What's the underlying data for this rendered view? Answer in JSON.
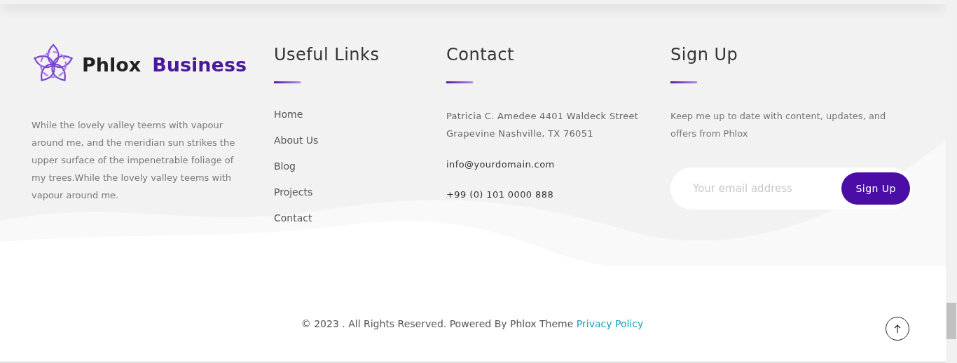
{
  "brand": {
    "name": "Phlox",
    "accent": "Business"
  },
  "about": "While the lovely valley teems with vapour around me, and the meridian sun strikes the upper surface of the impenetrable foliage of my trees.While the lovely valley teems with vapour around me.",
  "useful_links": {
    "title": "Useful Links",
    "items": [
      "Home",
      "About Us",
      "Blog",
      "Projects",
      "Contact"
    ]
  },
  "contact": {
    "title": "Contact",
    "address": "Patricia C. Amedee 4401 Waldeck Street Grapevine Nashville, TX 76051",
    "email": "info@yourdomain.com",
    "phone": "+99 (0) 101 0000 888"
  },
  "signup": {
    "title": "Sign Up",
    "text": "Keep me up to date with content, updates, and offers from Phlox",
    "placeholder": "Your email address",
    "button": "Sign Up"
  },
  "copyright": {
    "text": "© 2023 . All Rights Reserved. Powered By Phlox Theme",
    "link": "Privacy Policy"
  }
}
